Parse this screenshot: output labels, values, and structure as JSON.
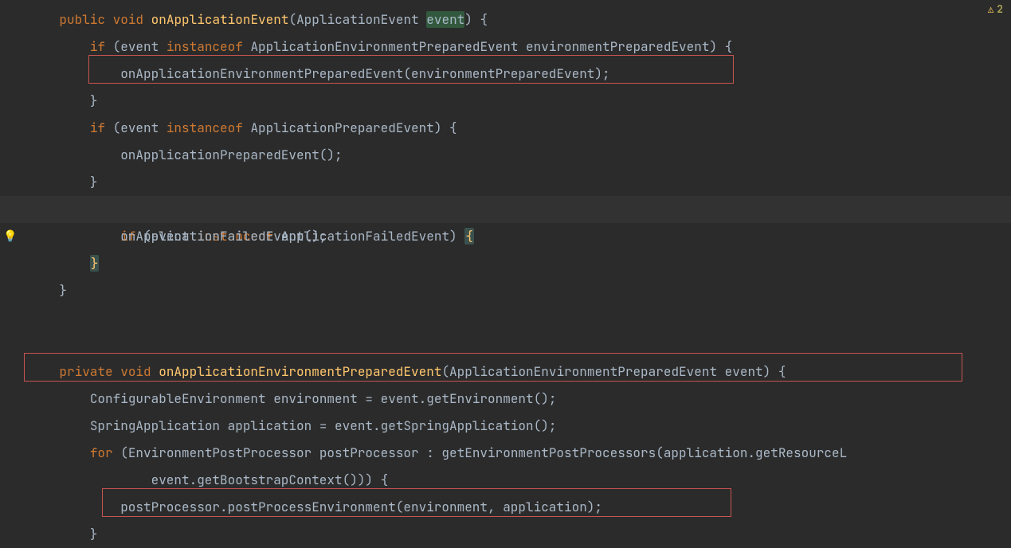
{
  "warnings": {
    "count": "2"
  },
  "code": {
    "l1": {
      "kw1": "public",
      "kw2": "void",
      "method": "onApplicationEvent",
      "p": "(",
      "type": "ApplicationEvent ",
      "param": "event",
      "close": ") {"
    },
    "l2": {
      "kw": "if",
      "open": " (event ",
      "inst": "instanceof",
      "rest": " ApplicationEnvironmentPreparedEvent environmentPreparedEvent) {"
    },
    "l3": {
      "call": "onApplicationEnvironmentPreparedEvent(environmentPreparedEvent);"
    },
    "l4": {
      "t": "}"
    },
    "l5": {
      "kw": "if",
      "open": " (event ",
      "inst": "instanceof",
      "rest": " ApplicationPreparedEvent) {"
    },
    "l6": {
      "call": "onApplicationPreparedEvent();"
    },
    "l7": {
      "t": "}"
    },
    "l8": {
      "kw": "if",
      "open": " (event ",
      "inst": "instanceof",
      "rest": " ApplicationFailedEvent) ",
      "brace": "{"
    },
    "l9": {
      "call": "onApplicationFailedEvent();"
    },
    "l10": {
      "t": "}"
    },
    "l11": {
      "t": "}"
    },
    "l12": {
      "t": ""
    },
    "l13": {
      "t": ""
    },
    "l14": {
      "kw1": "private",
      "kw2": "void",
      "method": "onApplicationEnvironmentPreparedEvent",
      "rest": "(ApplicationEnvironmentPreparedEvent event) {"
    },
    "l15": {
      "t": "ConfigurableEnvironment environment = event.getEnvironment();"
    },
    "l16": {
      "t": "SpringApplication application = event.getSpringApplication();"
    },
    "l17": {
      "kw": "for",
      "rest": " (EnvironmentPostProcessor postProcessor : getEnvironmentPostProcessors(application.getResourceL"
    },
    "l18": {
      "t": "event.getBootstrapContext())) {"
    },
    "l19": {
      "t": "postProcessor.postProcessEnvironment(environment, application);"
    },
    "l20": {
      "t": "}"
    }
  }
}
